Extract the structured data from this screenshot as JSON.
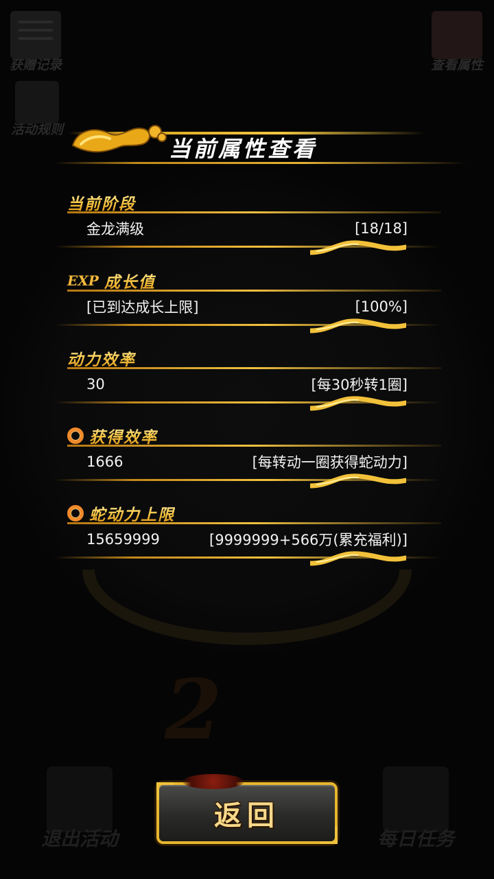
{
  "background": {
    "top_left_button": "获赠记录",
    "top_right_button": "查看属性",
    "rules_button": "活动规则",
    "bottom_left_button": "退出活动",
    "bottom_right_button": "每日任务"
  },
  "panel": {
    "title": "当前属性查看",
    "rows": [
      {
        "label": "当前阶段",
        "value": "金龙满级",
        "detail": "[18/18]",
        "icon": "none"
      },
      {
        "label": "成长值",
        "value": "[已到达成长上限]",
        "detail": "[100%]",
        "icon": "exp-icon",
        "icon_text": "EXP"
      },
      {
        "label": "动力效率",
        "value": "30",
        "detail": "[每30秒转1圈]",
        "icon": "none"
      },
      {
        "label": "获得效率",
        "value": "1666",
        "detail": "[每转动一圈获得蛇动力]",
        "icon": "ring-icon"
      },
      {
        "label": "蛇动力上限",
        "value": "15659999",
        "detail": "[9999999+566万(累充福利)]",
        "icon": "ring-icon"
      }
    ]
  },
  "back_button": {
    "label": "返回"
  },
  "colors": {
    "gold": "#f0c040",
    "label_gold": "#f7c846",
    "ring": "#f08a2a",
    "background": "#000000"
  }
}
